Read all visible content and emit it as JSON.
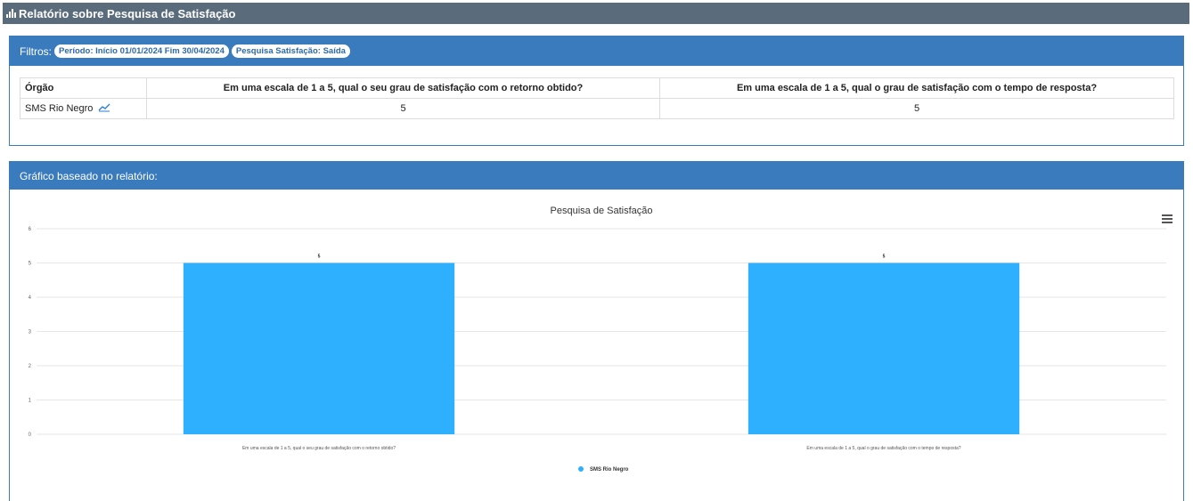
{
  "header": {
    "title": "Relatório sobre Pesquisa de Satisfação",
    "icon": "bar-chart-icon"
  },
  "filters": {
    "label": "Filtros:",
    "pills": [
      "Período: Início 01/01/2024 Fim 30/04/2024",
      "Pesquisa Satisfação: Saída"
    ]
  },
  "table": {
    "headers": [
      "Órgão",
      "Em uma escala de 1 a 5, qual o seu grau de satisfação com o retorno obtido?",
      "Em uma escala de 1 a 5, qual o grau de satisfação com o tempo de resposta?"
    ],
    "rows": [
      {
        "orgao": "SMS Rio Negro",
        "icon": "trend-chart-icon",
        "values": [
          "5",
          "5"
        ]
      }
    ]
  },
  "chart_panel": {
    "title": "Gráfico baseado no relatório:"
  },
  "chart_data": {
    "type": "bar",
    "title": "Pesquisa de Satisfação",
    "categories": [
      "Em uma escala de 1 a 5, qual o seu grau de satisfação com o retorno obtido?",
      "Em uma escala de 1 a 5, qual o grau de satisfação com o tempo de resposta?"
    ],
    "series": [
      {
        "name": "SMS Rio Negro",
        "values": [
          5,
          5
        ],
        "color": "#2fb0ff"
      }
    ],
    "data_labels": [
      "5",
      "5"
    ],
    "yticks": [
      0,
      1,
      2,
      3,
      4,
      5,
      6
    ],
    "ylim": [
      0,
      6
    ],
    "grid": true,
    "legend": "bottom-center"
  }
}
